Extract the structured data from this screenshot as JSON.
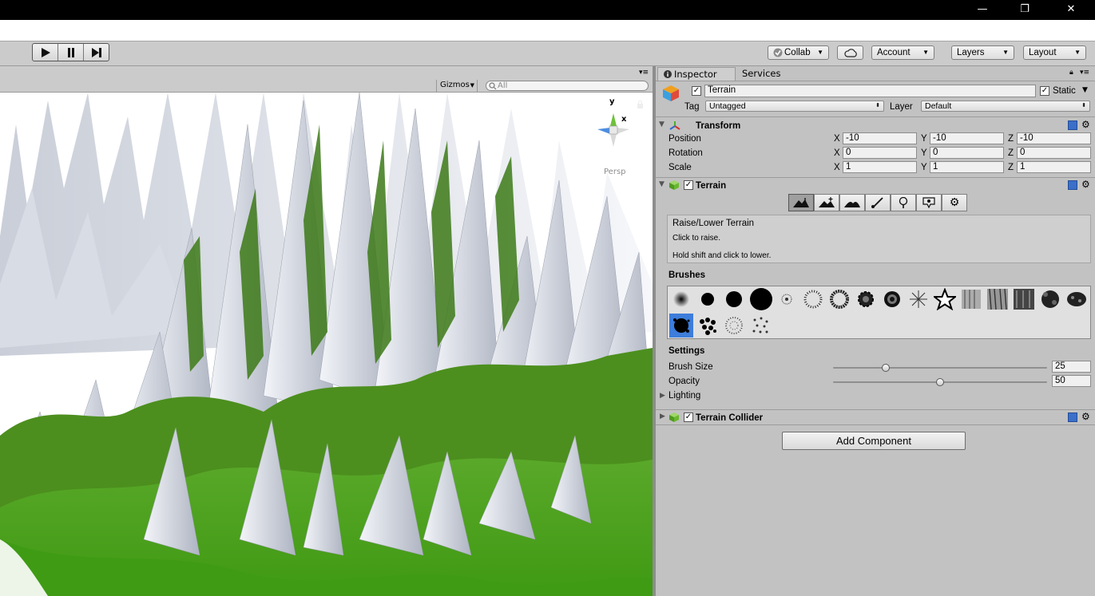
{
  "window": {
    "minimize": "—",
    "restore": "❐",
    "close": "✕"
  },
  "toolbar": {
    "collab_label": "Collab",
    "account_label": "Account",
    "layers_label": "Layers",
    "layout_label": "Layout"
  },
  "scene": {
    "gizmos_label": "Gizmos",
    "search_placeholder": "All",
    "persp_label": "Persp",
    "axis_y": "y",
    "axis_x": "x"
  },
  "inspector": {
    "tabs": [
      {
        "label": "Inspector"
      },
      {
        "label": "Services"
      }
    ],
    "object_name": "Terrain",
    "static_label": "Static",
    "tag_label": "Tag",
    "tag_value": "Untagged",
    "layer_label": "Layer",
    "layer_value": "Default",
    "transform": {
      "title": "Transform",
      "rows": [
        {
          "label": "Position",
          "x": "-10",
          "y": "-10",
          "z": "-10"
        },
        {
          "label": "Rotation",
          "x": "0",
          "y": "0",
          "z": "0"
        },
        {
          "label": "Scale",
          "x": "1",
          "y": "1",
          "z": "1"
        }
      ],
      "axis_x": "X",
      "axis_y": "Y",
      "axis_z": "Z"
    },
    "terrain": {
      "title": "Terrain",
      "tool_title": "Raise/Lower Terrain",
      "tool_line1": "Click to raise.",
      "tool_line2": "Hold shift and click to lower.",
      "brushes_label": "Brushes",
      "settings_label": "Settings",
      "brush_size_label": "Brush Size",
      "brush_size_value": "25",
      "brush_size_fraction": 0.25,
      "opacity_label": "Opacity",
      "opacity_value": "50",
      "opacity_fraction": 0.5,
      "lighting_label": "Lighting"
    },
    "collider_title": "Terrain Collider",
    "add_component_label": "Add Component"
  },
  "colors": {
    "selected_brush": "#3d7ddb",
    "terrain_green": "#4fa61a",
    "rock": "#dfe3ea"
  }
}
